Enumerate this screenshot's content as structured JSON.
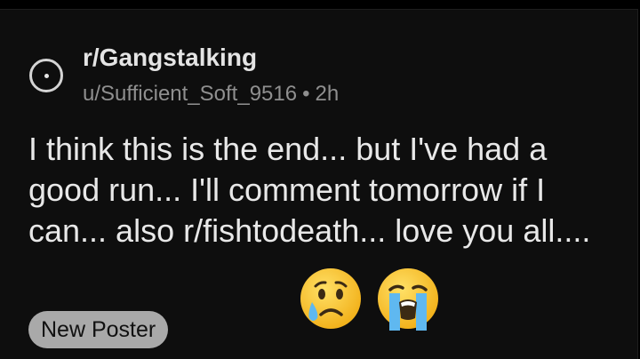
{
  "post": {
    "subreddit": "r/Gangstalking",
    "author": "u/Sufficient_Soft_9516",
    "separator": "•",
    "age": "2h",
    "body": "I think this is the end... but I've had a good run... I'll comment tomorrow if I can... also r/fishtodeath... love you all....",
    "emojis": [
      "crying-face-emoji",
      "loudly-crying-face-emoji"
    ],
    "flair": "New Poster"
  },
  "colors": {
    "background": "#000000",
    "card": "#0e0e0e",
    "text": "#e8e8e8",
    "meta": "#8f8f8f",
    "flair_bg": "#a9a9a9",
    "emoji_yellow": "#f7c12d",
    "tear_blue": "#5fb8f0"
  }
}
